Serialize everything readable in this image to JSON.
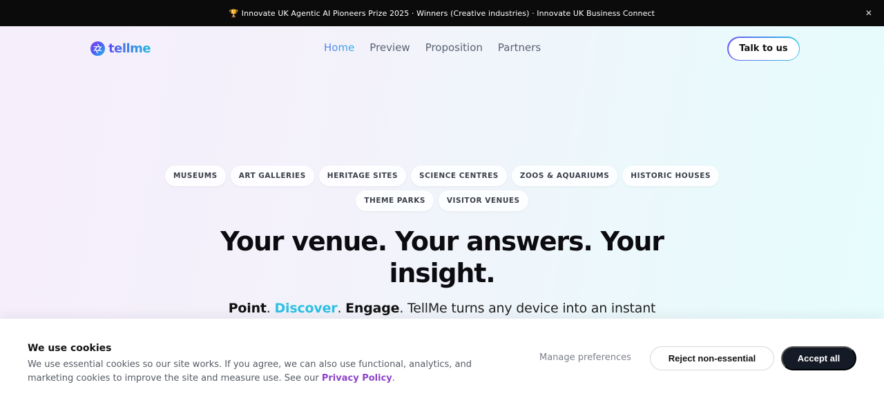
{
  "announcement": {
    "icon": "trophy-icon",
    "text": "Innovate UK Agentic AI Pioneers Prize 2025 · Winners (Creative industries) · Innovate UK Business Connect",
    "close_icon": "close-icon"
  },
  "header": {
    "logo_text": "tellme",
    "nav": [
      "Home",
      "Preview",
      "Proposition",
      "Partners"
    ],
    "active_nav": "Home",
    "cta": "Talk to us"
  },
  "hero": {
    "tags_row1": [
      "MUSEUMS",
      "ART GALLERIES",
      "HERITAGE SITES",
      "SCIENCE CENTRES",
      "ZOOS & AQUARIUMS",
      "HISTORIC HOUSES"
    ],
    "tags_row2": [
      "THEME PARKS",
      "VISITOR VENUES"
    ],
    "headline": "Your venue. Your answers. Your insight.",
    "sub_point": "Point",
    "sub_discover": "Discover",
    "sub_engage": "Engage",
    "sub_rest": ". TellMe turns any device into an instant"
  },
  "cookie": {
    "title": "We use cookies",
    "text": "We use essential cookies so our site works. If you agree, we can also use functional, analytics, and marketing cookies to improve the site and measure use. See our ",
    "link": "Privacy Policy",
    "link_suffix": ".",
    "manage": "Manage preferences",
    "reject": "Reject non-essential",
    "accept": "Accept all"
  },
  "colors": {
    "accent_blue": "#2ec1e3",
    "accent_purple": "#8e44c8",
    "dark": "#141a26"
  }
}
